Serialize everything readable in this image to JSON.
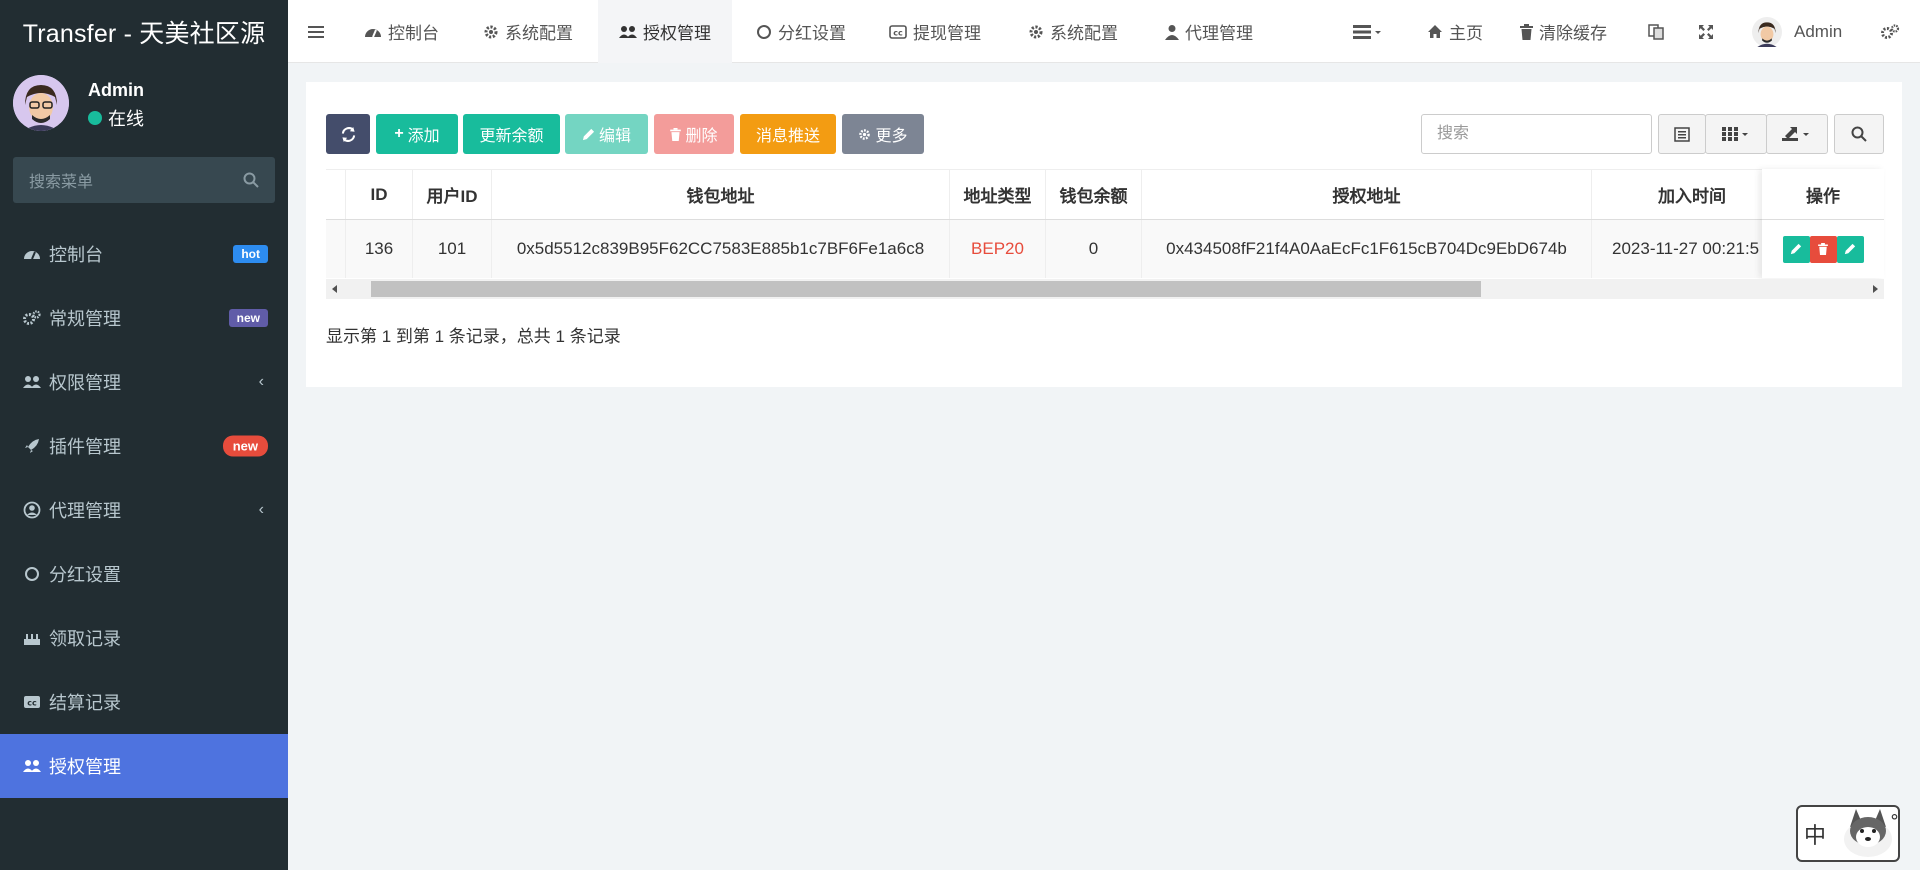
{
  "app": {
    "title": "Transfer - 天美社区源"
  },
  "user": {
    "name": "Admin",
    "status": "在线"
  },
  "sidebar": {
    "search_placeholder": "搜索菜单",
    "items": [
      {
        "label": "控制台",
        "icon": "dashboard-icon",
        "badge": "hot"
      },
      {
        "label": "常规管理",
        "icon": "cogs-icon",
        "badge": "new"
      },
      {
        "label": "权限管理",
        "icon": "group-icon",
        "chevron": true
      },
      {
        "label": "插件管理",
        "icon": "rocket-icon",
        "badge": "new"
      },
      {
        "label": "代理管理",
        "icon": "user-circle-icon",
        "chevron": true
      },
      {
        "label": "分红设置",
        "icon": "circle-o-icon"
      },
      {
        "label": "领取记录",
        "icon": "birthday-icon"
      },
      {
        "label": "结算记录",
        "icon": "cc-icon"
      },
      {
        "label": "授权管理",
        "icon": "group-icon",
        "active": true
      }
    ]
  },
  "topbar": {
    "tabs": [
      {
        "label": "控制台",
        "icon": "dashboard-icon"
      },
      {
        "label": "系统配置",
        "icon": "gear-icon"
      },
      {
        "label": "授权管理",
        "icon": "group-icon",
        "active": true
      },
      {
        "label": "分红设置",
        "icon": "circle-o-icon"
      },
      {
        "label": "提现管理",
        "icon": "cc-icon"
      },
      {
        "label": "系统配置",
        "icon": "gear-icon"
      },
      {
        "label": "代理管理",
        "icon": "user-icon"
      }
    ],
    "home": "主页",
    "clear_cache": "清除缓存",
    "admin": "Admin"
  },
  "toolbar": {
    "add": "添加",
    "update_balance": "更新余额",
    "edit": "编辑",
    "delete": "删除",
    "push": "消息推送",
    "more": "更多",
    "search_placeholder": "搜索"
  },
  "table": {
    "columns": [
      "ID",
      "用户ID",
      "钱包地址",
      "地址类型",
      "钱包余额",
      "授权地址",
      "加入时间",
      "操作"
    ],
    "rows": [
      {
        "id": "136",
        "user_id": "101",
        "wallet": "0x5d5512c839B95F62CC7583E885b1c7BF6Fe1a6c8",
        "type": "BEP20",
        "balance": "0",
        "auth_address": "0x434508fF21f4A0AaEcFc1F615cB704Dc9EbD674b",
        "joined": "2023-11-27 00:21:5"
      }
    ],
    "summary": "显示第 1 到第 1 条记录，总共 1 条记录"
  },
  "colors": {
    "sidebar_bg": "#222d32",
    "active_menu": "#4e73df",
    "primary_btn": "#18bc9c",
    "danger_btn": "#f39c9a",
    "warning_btn": "#f39c12",
    "dark_btn": "#444d6b",
    "type_text": "#e74c3c"
  },
  "ime": {
    "label": "中"
  }
}
